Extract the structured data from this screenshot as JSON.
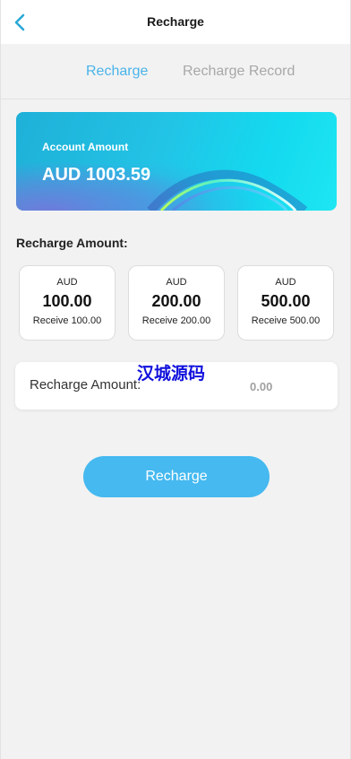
{
  "header": {
    "title": "Recharge",
    "back_icon": "chevron-left-icon",
    "accent": "#2aa8d8"
  },
  "tabs": [
    {
      "label": "Recharge",
      "active": true
    },
    {
      "label": "Recharge Record",
      "active": false
    }
  ],
  "account": {
    "label": "Account Amount",
    "value": "AUD 1003.59"
  },
  "amounts": {
    "label": "Recharge Amount:",
    "options": [
      {
        "currency": "AUD",
        "value": "100.00",
        "receive": "Receive 100.00"
      },
      {
        "currency": "AUD",
        "value": "200.00",
        "receive": "Receive 200.00"
      },
      {
        "currency": "AUD",
        "value": "500.00",
        "receive": "Receive 500.00"
      }
    ]
  },
  "custom_amount": {
    "label": "Recharge Amount:",
    "placeholder": "0.00"
  },
  "watermark": "汉城源码",
  "submit": {
    "label": "Recharge",
    "color": "#45b9f0"
  }
}
